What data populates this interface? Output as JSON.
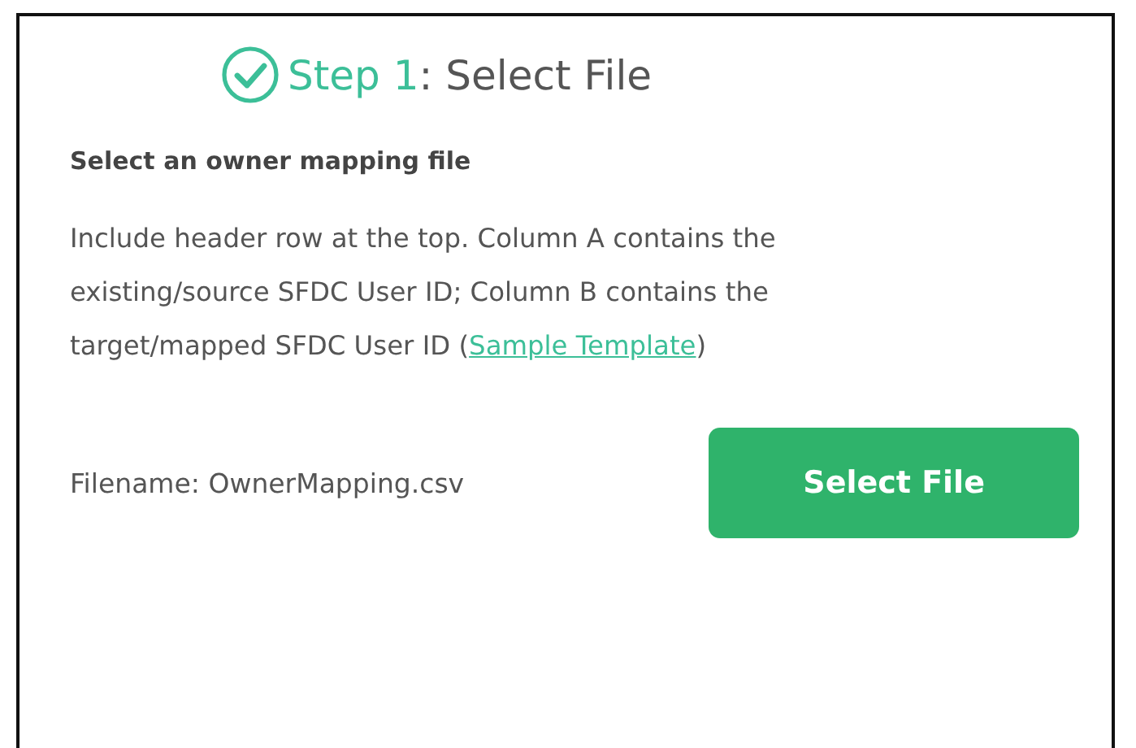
{
  "step": {
    "number_label": "Step 1",
    "title": ": Select File",
    "completed": true
  },
  "section_heading": "Select an owner mapping file",
  "description": {
    "text": "Include header row at the top. Column A contains the existing/source SFDC User ID; Column B contains the target/mapped SFDC User ID (",
    "link": "Sample Template",
    "text_after": ")"
  },
  "filename": "Filename: OwnerMapping.csv",
  "button": "Select File"
}
